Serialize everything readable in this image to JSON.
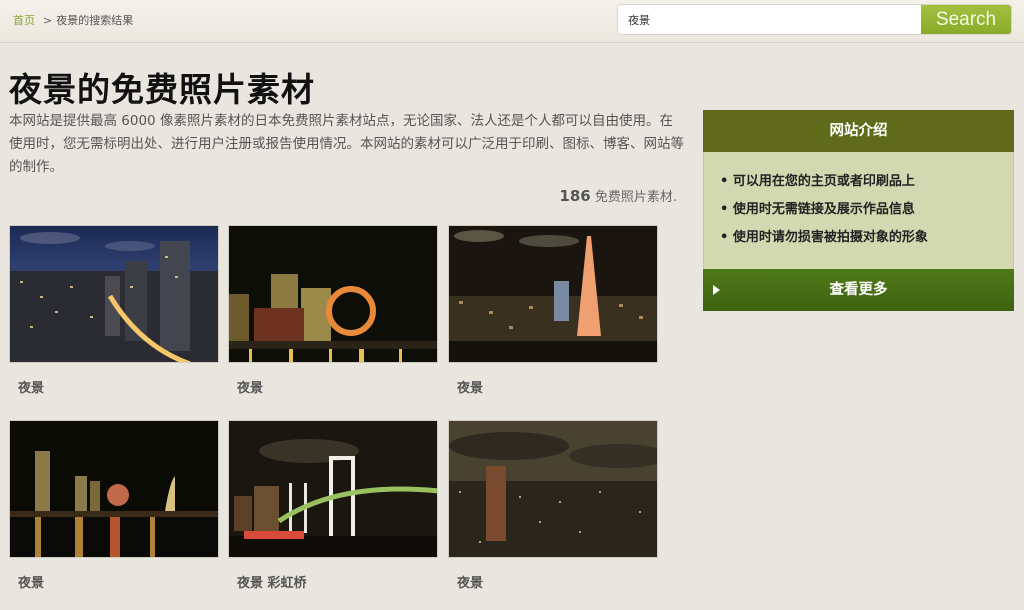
{
  "header": {
    "breadcrumb": {
      "home": "首页",
      "separator": ">",
      "current": "夜景的搜索结果"
    },
    "search": {
      "value": "夜景",
      "button_label": "Search"
    }
  },
  "main": {
    "title": "夜景的免费照片素材",
    "intro": "本网站是提供最高 6000 像素照片素材的日本免费照片素材站点，无论国家、法人还是个人都可以自由使用。在使用时，您无需标明出处、进行用户注册或报告使用情况。本网站的素材可以广泛用于印刷、图标、博客、网站等的制作。",
    "count": {
      "number": "186",
      "label": "免费照片素材."
    },
    "photos": [
      {
        "caption": "夜景",
        "scene": "city-skyline-highway"
      },
      {
        "caption": "夜景",
        "scene": "waterfront-ferris-wheel"
      },
      {
        "caption": "夜景",
        "scene": "tokyo-tower"
      },
      {
        "caption": "夜景",
        "scene": "harbor-reflections"
      },
      {
        "caption": "夜景 彩虹桥",
        "scene": "rainbow-bridge"
      },
      {
        "caption": "夜景",
        "scene": "city-aerial-cloudy"
      }
    ]
  },
  "sidebar": {
    "title": "网站介绍",
    "items": [
      "可以用在您的主页或者印刷品上",
      "使用时无需链接及展示作品信息",
      "使用时请勿损害被拍摄对象的形象"
    ],
    "bullet": "•",
    "more_label": "查看更多"
  },
  "colors": {
    "accent": "#8aab2a",
    "sidebar_header": "#5f6b1b",
    "sidebar_body": "#d2d8b0",
    "sidebar_button": "#46691a",
    "background": "#e9e6df"
  }
}
